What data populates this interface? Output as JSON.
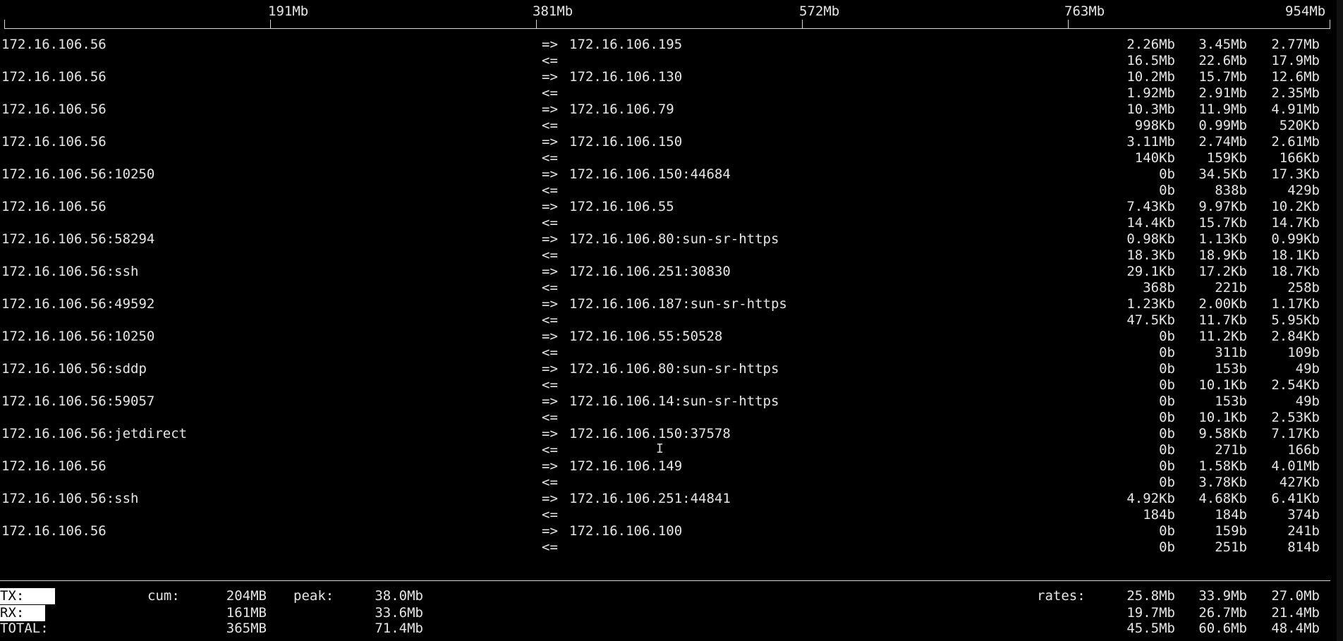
{
  "scale": {
    "labels": [
      "191Mb",
      "381Mb",
      "572Mb",
      "763Mb",
      "954Mb"
    ]
  },
  "connections": [
    {
      "src": "172.16.106.56",
      "dst": "172.16.106.195",
      "tx": [
        "2.26Mb",
        "3.45Mb",
        "2.77Mb"
      ],
      "rx": [
        "16.5Mb",
        "22.6Mb",
        "17.9Mb"
      ]
    },
    {
      "src": "172.16.106.56",
      "dst": "172.16.106.130",
      "tx": [
        "10.2Mb",
        "15.7Mb",
        "12.6Mb"
      ],
      "rx": [
        "1.92Mb",
        "2.91Mb",
        "2.35Mb"
      ]
    },
    {
      "src": "172.16.106.56",
      "dst": "172.16.106.79",
      "tx": [
        "10.3Mb",
        "11.9Mb",
        "4.91Mb"
      ],
      "rx": [
        "998Kb",
        "0.99Mb",
        "520Kb"
      ]
    },
    {
      "src": "172.16.106.56",
      "dst": "172.16.106.150",
      "tx": [
        "3.11Mb",
        "2.74Mb",
        "2.61Mb"
      ],
      "rx": [
        "140Kb",
        "159Kb",
        "166Kb"
      ]
    },
    {
      "src": "172.16.106.56:10250",
      "dst": "172.16.106.150:44684",
      "tx": [
        "0b",
        "34.5Kb",
        "17.3Kb"
      ],
      "rx": [
        "0b",
        "838b",
        "429b"
      ]
    },
    {
      "src": "172.16.106.56",
      "dst": "172.16.106.55",
      "tx": [
        "7.43Kb",
        "9.97Kb",
        "10.2Kb"
      ],
      "rx": [
        "14.4Kb",
        "15.7Kb",
        "14.7Kb"
      ]
    },
    {
      "src": "172.16.106.56:58294",
      "dst": "172.16.106.80:sun-sr-https",
      "tx": [
        "0.98Kb",
        "1.13Kb",
        "0.99Kb"
      ],
      "rx": [
        "18.3Kb",
        "18.9Kb",
        "18.1Kb"
      ]
    },
    {
      "src": "172.16.106.56:ssh",
      "dst": "172.16.106.251:30830",
      "tx": [
        "29.1Kb",
        "17.2Kb",
        "18.7Kb"
      ],
      "rx": [
        "368b",
        "221b",
        "258b"
      ]
    },
    {
      "src": "172.16.106.56:49592",
      "dst": "172.16.106.187:sun-sr-https",
      "tx": [
        "1.23Kb",
        "2.00Kb",
        "1.17Kb"
      ],
      "rx": [
        "47.5Kb",
        "11.7Kb",
        "5.95Kb"
      ]
    },
    {
      "src": "172.16.106.56:10250",
      "dst": "172.16.106.55:50528",
      "tx": [
        "0b",
        "11.2Kb",
        "2.84Kb"
      ],
      "rx": [
        "0b",
        "311b",
        "109b"
      ]
    },
    {
      "src": "172.16.106.56:sddp",
      "dst": "172.16.106.80:sun-sr-https",
      "tx": [
        "0b",
        "153b",
        "49b"
      ],
      "rx": [
        "0b",
        "10.1Kb",
        "2.54Kb"
      ]
    },
    {
      "src": "172.16.106.56:59057",
      "dst": "172.16.106.14:sun-sr-https",
      "tx": [
        "0b",
        "153b",
        "49b"
      ],
      "rx": [
        "0b",
        "10.1Kb",
        "2.53Kb"
      ]
    },
    {
      "src": "172.16.106.56:jetdirect",
      "dst": "172.16.106.150:37578",
      "tx": [
        "0b",
        "9.58Kb",
        "7.17Kb"
      ],
      "rx": [
        "0b",
        "271b",
        "166b"
      ]
    },
    {
      "src": "172.16.106.56",
      "dst": "172.16.106.149",
      "tx": [
        "0b",
        "1.58Kb",
        "4.01Mb"
      ],
      "rx": [
        "0b",
        "3.78Kb",
        "427Kb"
      ]
    },
    {
      "src": "172.16.106.56:ssh",
      "dst": "172.16.106.251:44841",
      "tx": [
        "4.92Kb",
        "4.68Kb",
        "6.41Kb"
      ],
      "rx": [
        "184b",
        "184b",
        "374b"
      ]
    },
    {
      "src": "172.16.106.56",
      "dst": "172.16.106.100",
      "tx": [
        "0b",
        "159b",
        "241b"
      ],
      "rx": [
        "0b",
        "251b",
        "814b"
      ]
    }
  ],
  "arrows": {
    "out": "=>",
    "in": "<="
  },
  "footer": {
    "tx_label": "TX:",
    "rx_label": "RX:",
    "total_label": "TOTAL:",
    "cum_label": "cum:",
    "peak_label": "peak:",
    "rates_label": "rates:",
    "tx": {
      "cum": "204MB",
      "peak": "38.0Mb",
      "rates": [
        "25.8Mb",
        "33.9Mb",
        "27.0Mb"
      ]
    },
    "rx": {
      "cum": "161MB",
      "peak": "33.6Mb",
      "rates": [
        "19.7Mb",
        "26.7Mb",
        "21.4Mb"
      ]
    },
    "total": {
      "cum": "365MB",
      "peak": "71.4Mb",
      "rates": [
        "45.5Mb",
        "60.6Mb",
        "48.4Mb"
      ]
    }
  },
  "colors": {
    "background": "#000000",
    "foreground": "#e6e6e6",
    "highlight": "#ffffff"
  }
}
